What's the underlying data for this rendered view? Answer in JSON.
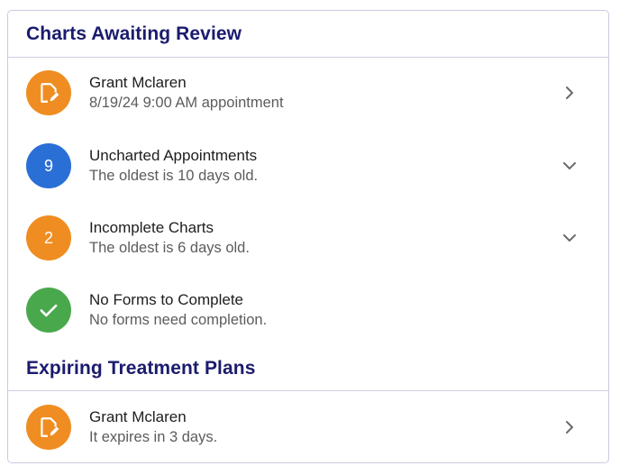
{
  "sections": {
    "review": {
      "title": "Charts Awaiting Review",
      "items": [
        {
          "title": "Grant Mclaren",
          "subtitle": "8/19/24 9:00 AM appointment",
          "badge_icon": "edit-document-icon",
          "badge_color": "#ef8d22",
          "action_icon": "chevron-right-icon"
        },
        {
          "title": "Uncharted Appointments",
          "subtitle": "The oldest is 10 days old.",
          "badge_count": "9",
          "badge_color": "#2a6fd6",
          "action_icon": "chevron-down-icon"
        },
        {
          "title": "Incomplete Charts",
          "subtitle": "The oldest is 6 days old.",
          "badge_count": "2",
          "badge_color": "#ef8d22",
          "action_icon": "chevron-down-icon"
        },
        {
          "title": "No Forms to Complete",
          "subtitle": "No forms need completion.",
          "badge_icon": "check-icon",
          "badge_color": "#4aa84c"
        }
      ]
    },
    "expiring": {
      "title": "Expiring Treatment Plans",
      "items": [
        {
          "title": "Grant Mclaren",
          "subtitle": "It expires in 3 days.",
          "badge_icon": "edit-document-icon",
          "badge_color": "#ef8d22",
          "action_icon": "chevron-right-icon"
        }
      ]
    }
  },
  "colors": {
    "heading": "#1b1b6e",
    "border": "#c9cbe0"
  }
}
